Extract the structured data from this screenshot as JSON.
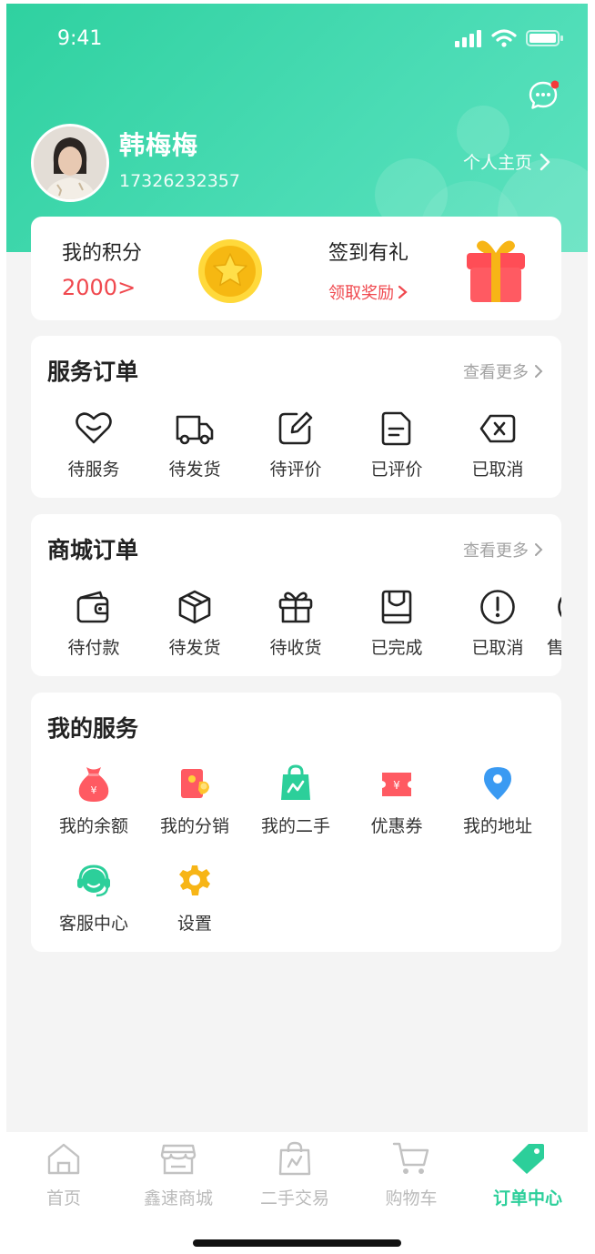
{
  "status_bar": {
    "time": "9:41"
  },
  "profile": {
    "name": "韩梅梅",
    "phone": "17326232357",
    "homepage_link": "个人主页"
  },
  "points": {
    "title": "我的积分",
    "value": "2000",
    "arrow": ">",
    "signin_title": "签到有礼",
    "signin_link": "领取奖励"
  },
  "service_orders": {
    "title": "服务订单",
    "more": "查看更多",
    "items": [
      {
        "label": "待服务",
        "icon": "heart-icon"
      },
      {
        "label": "待发货",
        "icon": "truck-icon"
      },
      {
        "label": "待评价",
        "icon": "edit-icon"
      },
      {
        "label": "已评价",
        "icon": "document-icon"
      },
      {
        "label": "已取消",
        "icon": "cancel-icon"
      }
    ]
  },
  "mall_orders": {
    "title": "商城订单",
    "more": "查看更多",
    "items": [
      {
        "label": "待付款",
        "icon": "wallet-icon"
      },
      {
        "label": "待发货",
        "icon": "box-icon"
      },
      {
        "label": "待收货",
        "icon": "gift-icon"
      },
      {
        "label": "已完成",
        "icon": "completed-icon"
      },
      {
        "label": "已取消",
        "icon": "alert-icon"
      },
      {
        "label": "售",
        "icon": "aftersale-icon"
      }
    ]
  },
  "my_services": {
    "title": "我的服务",
    "items": [
      {
        "label": "我的余额",
        "icon": "money-bag-icon"
      },
      {
        "label": "我的分销",
        "icon": "distribution-icon"
      },
      {
        "label": "我的二手",
        "icon": "shopping-bag-icon"
      },
      {
        "label": "优惠券",
        "icon": "coupon-icon"
      },
      {
        "label": "我的地址",
        "icon": "location-icon"
      },
      {
        "label": "客服中心",
        "icon": "headset-icon"
      },
      {
        "label": "设置",
        "icon": "settings-gear-icon"
      }
    ]
  },
  "tabbar": {
    "items": [
      {
        "label": "首页",
        "icon": "home-icon"
      },
      {
        "label": "鑫速商城",
        "icon": "store-icon"
      },
      {
        "label": "二手交易",
        "icon": "secondhand-bag-icon"
      },
      {
        "label": "购物车",
        "icon": "cart-icon"
      },
      {
        "label": "订单中心",
        "icon": "tag-icon",
        "active": true
      }
    ]
  },
  "colors": {
    "accent": "#2ccf9a",
    "price_red": "#f0484e",
    "background": "#f4f4f4"
  }
}
